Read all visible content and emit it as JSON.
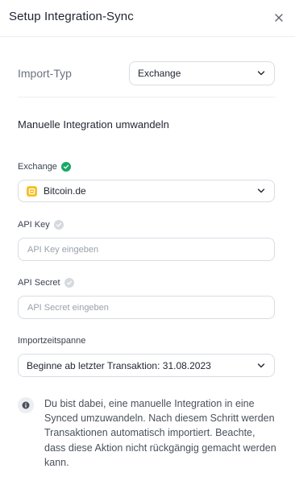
{
  "header": {
    "title": "Setup Integration-Sync",
    "close_icon": "close-icon"
  },
  "import_type": {
    "label": "Import-Typ",
    "value": "Exchange"
  },
  "section": {
    "title": "Manuelle Integration umwandeln"
  },
  "exchange": {
    "label": "Exchange",
    "value": "Bitcoin.de",
    "verified_color": "#18a865"
  },
  "api_key": {
    "label": "API Key",
    "placeholder": "API Key eingeben"
  },
  "api_secret": {
    "label": "API Secret",
    "placeholder": "API Secret eingeben"
  },
  "period": {
    "label": "Importzeitspanne",
    "value": "Beginne ab letzter Transaktion: 31.08.2023"
  },
  "info": {
    "text": "Du bist dabei, eine manuelle Integration in eine Synced umzuwandeln. Nach diesem Schritt werden Transaktionen automatisch importiert. Beachte, dass diese Aktion nicht rückgängig gemacht werden kann."
  }
}
